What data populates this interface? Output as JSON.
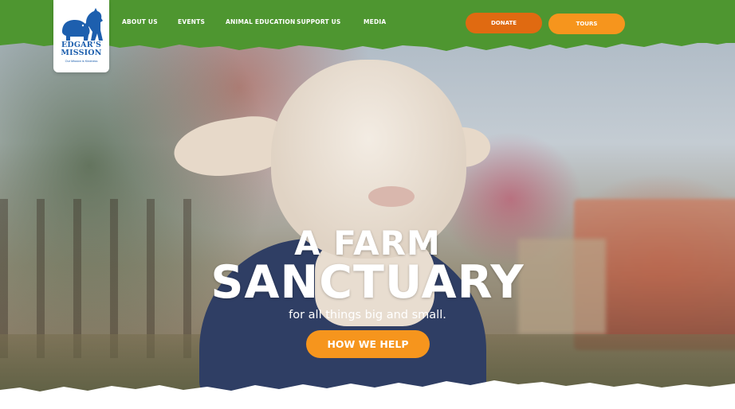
{
  "brand": {
    "name": "EDGAR'S\nMISSION",
    "tagline": "Our Mission is Kindness",
    "color": "#1d5fae"
  },
  "nav": {
    "items": [
      {
        "label": "ABOUT US"
      },
      {
        "label": "EVENTS"
      },
      {
        "label": "ANIMAL EDUCATION"
      },
      {
        "label": "SUPPORT US"
      },
      {
        "label": "MEDIA"
      }
    ],
    "donate_label": "DONATE",
    "tours_label": "TOURS"
  },
  "hero": {
    "title_line1": "A FARM",
    "title_line2": "SANCTUARY",
    "subtitle": "for all things big and small.",
    "cta_label": "HOW WE HELP",
    "image": "lamb-in-blue-coat-photo"
  },
  "colors": {
    "header_green": "#4e9630",
    "donate_orange": "#e06a11",
    "accent_orange": "#f6951d",
    "white": "#ffffff"
  }
}
